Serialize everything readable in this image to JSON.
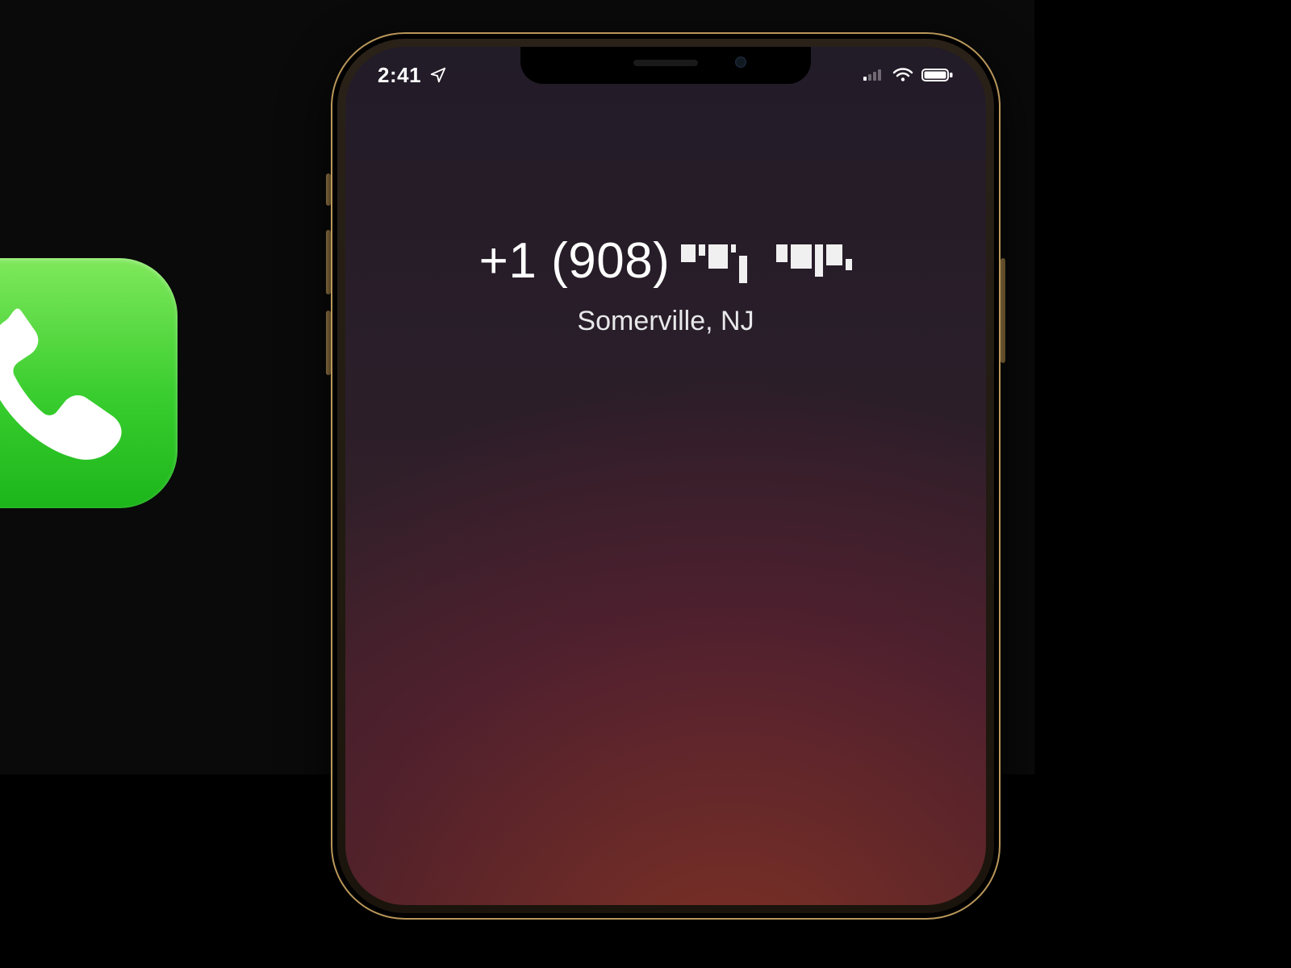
{
  "status": {
    "time": "2:41",
    "location_icon": "location-arrow",
    "battery_icon": "battery-full",
    "wifi_icon": "wifi",
    "signal_icon": "signal"
  },
  "call": {
    "number_visible": "+1 (908)",
    "number_obscured": true,
    "location": "Somerville, NJ"
  },
  "app_icon": {
    "name": "phone-app"
  }
}
